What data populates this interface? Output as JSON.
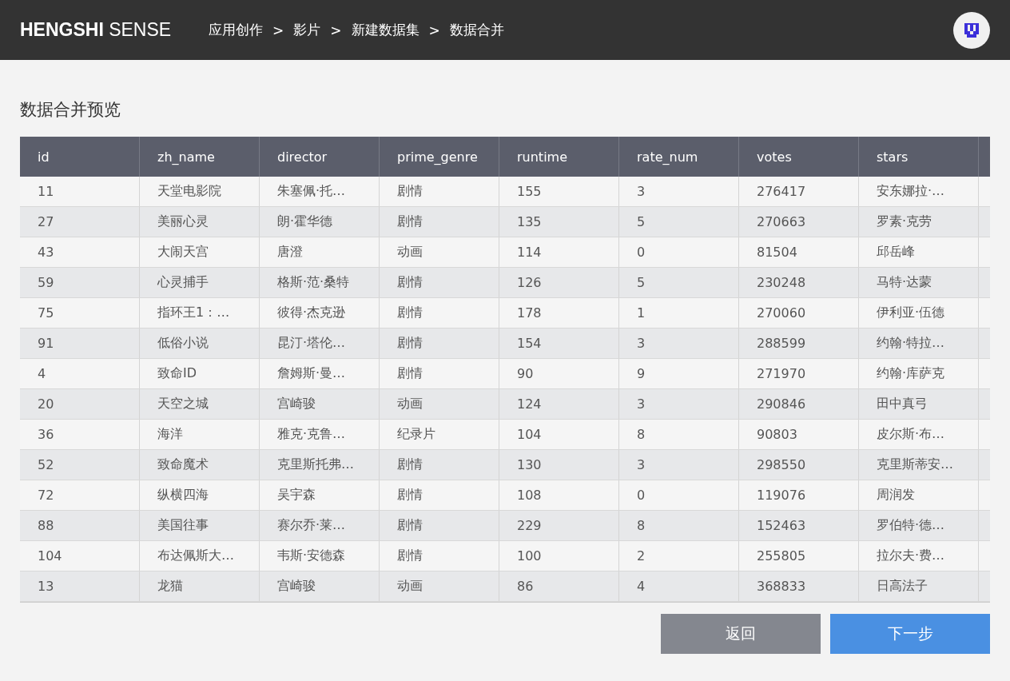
{
  "header": {
    "logo_bold": "HENGSHI",
    "logo_light": "SENSE",
    "breadcrumb": [
      "应用创作",
      "影片",
      "新建数据集",
      "数据合并"
    ],
    "separator": ">"
  },
  "page": {
    "title": "数据合并预览"
  },
  "table": {
    "columns": [
      "id",
      "zh_name",
      "director",
      "prime_genre",
      "runtime",
      "rate_num",
      "votes",
      "stars"
    ],
    "rows": [
      [
        "11",
        "天堂电影院",
        "朱塞佩·托…",
        "剧情",
        "155",
        "3",
        "276417",
        "安东娜拉·…"
      ],
      [
        "27",
        "美丽心灵",
        "朗·霍华德",
        "剧情",
        "135",
        "5",
        "270663",
        "罗素·克劳"
      ],
      [
        "43",
        "大闹天宫",
        "唐澄",
        "动画",
        "114",
        "0",
        "81504",
        "邱岳峰"
      ],
      [
        "59",
        "心灵捕手",
        "格斯·范·桑特",
        "剧情",
        "126",
        "5",
        "230248",
        "马特·达蒙"
      ],
      [
        "75",
        "指环王1：…",
        "彼得·杰克逊",
        "剧情",
        "178",
        "1",
        "270060",
        "伊利亚·伍德"
      ],
      [
        "91",
        "低俗小说",
        "昆汀·塔伦…",
        "剧情",
        "154",
        "3",
        "288599",
        "约翰·特拉…"
      ],
      [
        "4",
        "致命ID",
        "詹姆斯·曼…",
        "剧情",
        "90",
        "9",
        "271970",
        "约翰·库萨克"
      ],
      [
        "20",
        "天空之城",
        "宫崎骏",
        "动画",
        "124",
        "3",
        "290846",
        "田中真弓"
      ],
      [
        "36",
        "海洋",
        "雅克·克鲁…",
        "纪录片",
        "104",
        "8",
        "90803",
        "皮尔斯·布…"
      ],
      [
        "52",
        "致命魔术",
        "克里斯托弗…",
        "剧情",
        "130",
        "3",
        "298550",
        "克里斯蒂安…"
      ],
      [
        "72",
        "纵横四海",
        "吴宇森",
        "剧情",
        "108",
        "0",
        "119076",
        "周润发"
      ],
      [
        "88",
        "美国往事",
        "赛尔乔·莱…",
        "剧情",
        "229",
        "8",
        "152463",
        "罗伯特·德…"
      ],
      [
        "104",
        "布达佩斯大…",
        "韦斯·安德森",
        "剧情",
        "100",
        "2",
        "255805",
        "拉尔夫·费…"
      ],
      [
        "13",
        "龙猫",
        "宫崎骏",
        "动画",
        "86",
        "4",
        "368833",
        "日高法子"
      ]
    ]
  },
  "buttons": [
    {
      "label": "返回",
      "kind": "secondary"
    },
    {
      "label": "下一步",
      "kind": "primary"
    }
  ]
}
